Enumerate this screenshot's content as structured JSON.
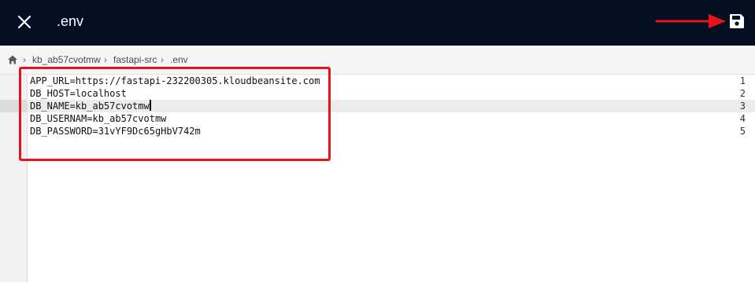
{
  "header": {
    "file_name": ".env",
    "background_color": "#050f24",
    "close_icon": "close-icon",
    "save_icon": "floppy-disk-icon"
  },
  "breadcrumb": {
    "home_icon": "home-icon",
    "separator": "›",
    "items": [
      "kb_ab57cvotmw",
      "fastapi-src",
      ".env"
    ]
  },
  "editor": {
    "active_line": 3,
    "lines": [
      {
        "number": "1",
        "text": "APP_URL=https://fastapi-232200305.kloudbeansite.com"
      },
      {
        "number": "2",
        "text": "DB_HOST=localhost"
      },
      {
        "number": "3",
        "text": "DB_NAME=kb_ab57cvotmw"
      },
      {
        "number": "4",
        "text": "DB_USERNAM=kb_ab57cvotmw"
      },
      {
        "number": "5",
        "text": "DB_PASSWORD=31vYF9Dc65gHbV742m"
      }
    ]
  },
  "annotations": {
    "highlight_color": "#e8141a"
  }
}
